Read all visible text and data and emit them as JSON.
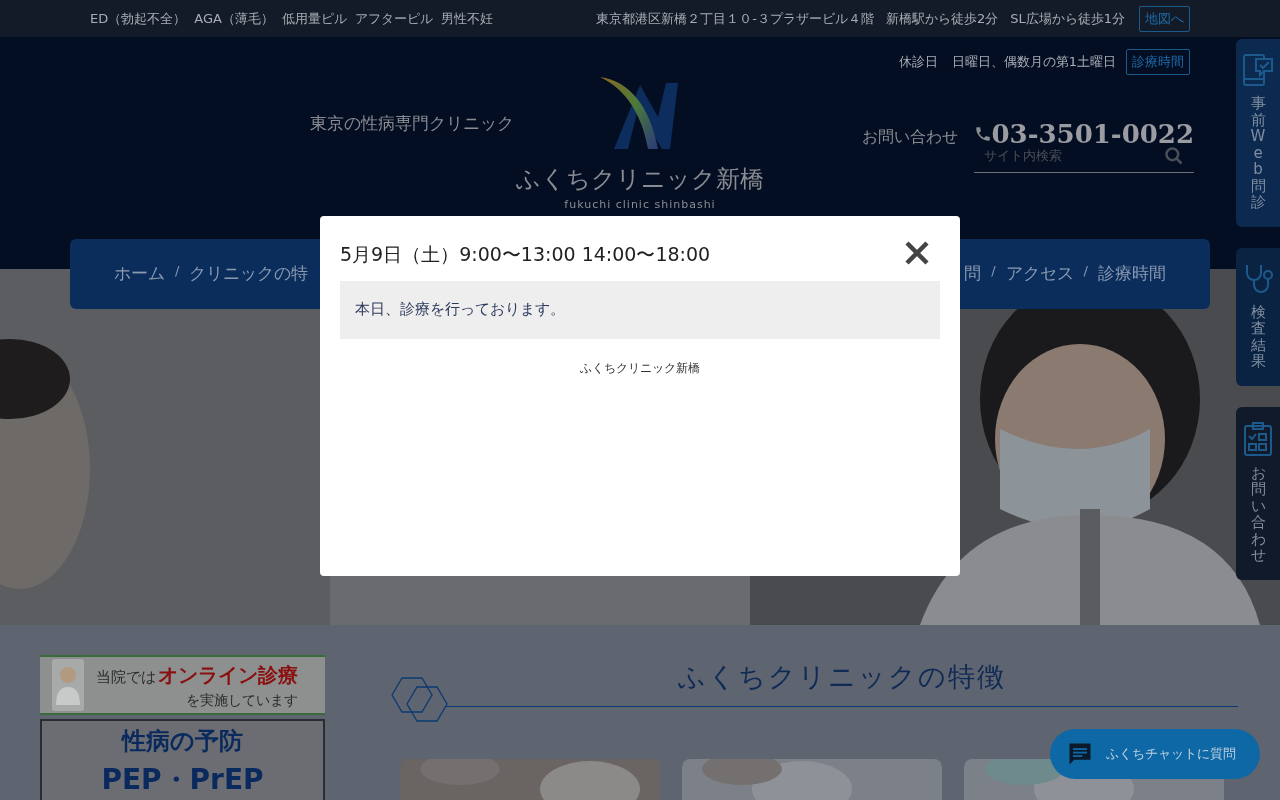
{
  "top_bar": {
    "links": [
      "ED（勃起不全）",
      "AGA（薄毛）",
      "低用量ピル",
      "アフターピル",
      "男性不妊"
    ],
    "address": "東京都港区新橋２丁目１０-３プラザービル４階",
    "access": [
      "新橋駅から徒歩2分",
      "SL広場から徒歩1分"
    ],
    "map_button": "地図へ"
  },
  "header": {
    "closed_label": "休診日",
    "closed_days": "日曜日、偶数月の第1土曜日",
    "hours_button": "診療時間",
    "tagline": "東京の性病専門クリニック",
    "logo_name": "ふくちクリニック新橋",
    "logo_roman": "fukuchi clinic shinbashi",
    "contact_label": "お問い合わせ",
    "phone": "03-3501-0022",
    "search": {
      "placeholder": "サイト内検索"
    }
  },
  "nav": {
    "left": [
      {
        "label": "ホーム",
        "separator": "/"
      },
      {
        "label": "クリニックの特"
      }
    ],
    "right": [
      {
        "label": "問",
        "separator": "/"
      },
      {
        "label": "アクセス",
        "separator": "/"
      },
      {
        "label": "診療時間"
      }
    ]
  },
  "side_tabs": [
    {
      "label": "事前Web問診",
      "kind": "web"
    },
    {
      "label": "検査結果",
      "kind": "stethoscope"
    },
    {
      "label": "お問い合わせ",
      "kind": "clipboard"
    }
  ],
  "banner": {
    "lead": "当院では",
    "highlight": "オンライン診療",
    "tail": "を実施しています"
  },
  "prep_box": [
    "性病の予防",
    "PEP・PrEP"
  ],
  "features_title": "ふくちクリニックの特徴",
  "chat_button": "ふくちチャットに質問",
  "modal": {
    "title": "5月9日（土）9:00〜13:00 14:00〜18:00",
    "notice": "本日、診療を行っております。",
    "footer": "ふくちクリニック新橋"
  }
}
